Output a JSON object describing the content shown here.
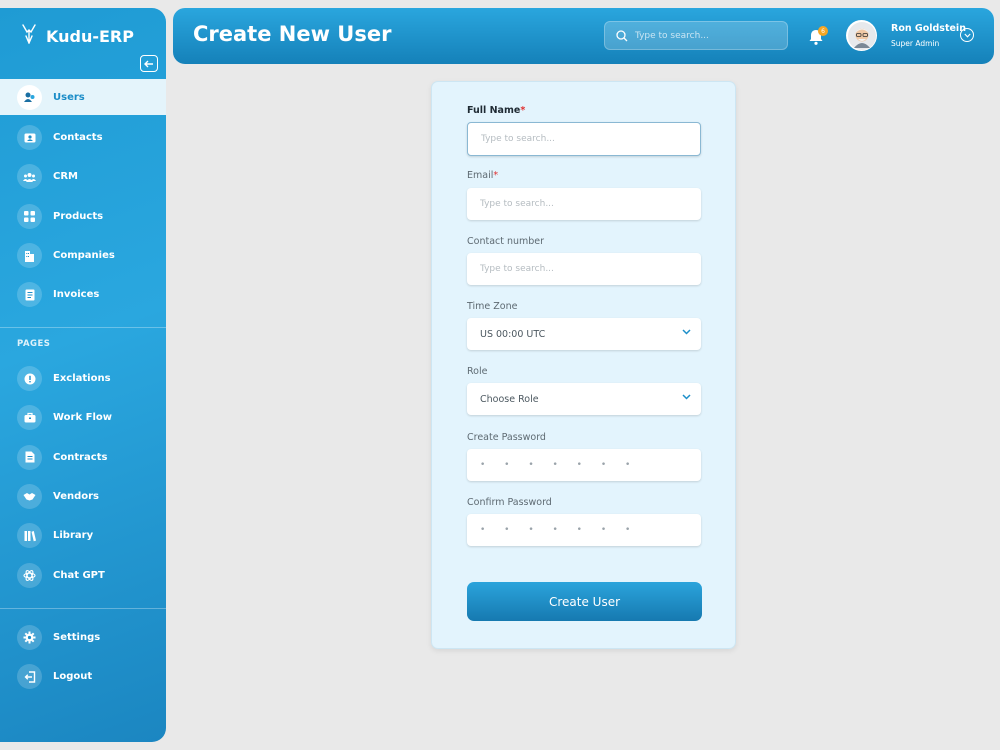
{
  "app": {
    "name": "Kudu-ERP"
  },
  "header": {
    "title": "Create New User",
    "search_placeholder": "Type to search...",
    "notification_count": "6",
    "user": {
      "name": "Ron Goldstein",
      "role": "Super Admin"
    }
  },
  "sidebar": {
    "main_items": [
      {
        "label": "Users",
        "icon": "users-icon",
        "active": true
      },
      {
        "label": "Contacts",
        "icon": "contact-card-icon"
      },
      {
        "label": "CRM",
        "icon": "group-icon"
      },
      {
        "label": "Products",
        "icon": "grid-icon"
      },
      {
        "label": "Companies",
        "icon": "building-icon"
      },
      {
        "label": "Invoices",
        "icon": "invoice-icon"
      }
    ],
    "pages_label": "PAGES",
    "page_items": [
      {
        "label": "Exclations",
        "icon": "alert-icon"
      },
      {
        "label": "Work Flow",
        "icon": "briefcase-icon"
      },
      {
        "label": "Contracts",
        "icon": "document-icon"
      },
      {
        "label": "Vendors",
        "icon": "handshake-icon"
      },
      {
        "label": "Library",
        "icon": "books-icon"
      },
      {
        "label": "Chat GPT",
        "icon": "openai-icon"
      }
    ],
    "bottom_items": [
      {
        "label": "Settings",
        "icon": "gear-icon"
      },
      {
        "label": "Logout",
        "icon": "logout-icon"
      }
    ]
  },
  "form": {
    "full_name": {
      "label": "Full Name",
      "required_mark": "*",
      "placeholder": "Type to search..."
    },
    "email": {
      "label": "Email",
      "required_mark": "*",
      "placeholder": "Type to search..."
    },
    "contact": {
      "label": "Contact number",
      "placeholder": "Type to search..."
    },
    "timezone": {
      "label": "Time Zone",
      "value": "US 00:00 UTC"
    },
    "role": {
      "label": "Role",
      "value": "Choose Role"
    },
    "create_password": {
      "label": "Create Password",
      "value": "• • • • • • •"
    },
    "confirm_password": {
      "label": "Confirm Password",
      "value": "• • • • • • •"
    },
    "submit_label": "Create User"
  },
  "colors": {
    "accent": "#2aa6de",
    "accent_dark": "#1581b9",
    "card_bg": "#e3f4fd",
    "badge": "#f5a623",
    "required": "#e03131"
  }
}
